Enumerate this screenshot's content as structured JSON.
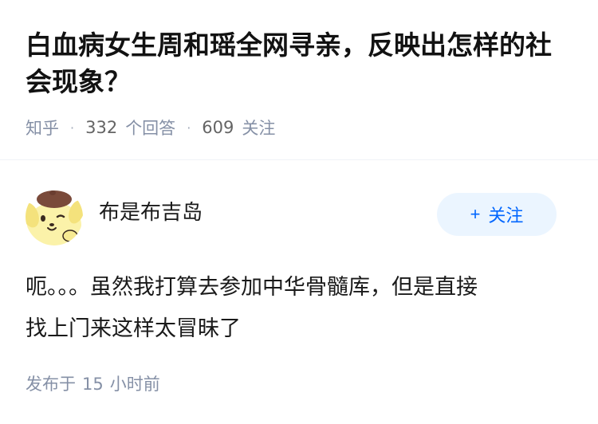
{
  "question": {
    "title": "白血病女生周和瑶全网寻亲，反映出怎样的社会现象？",
    "source": "知乎",
    "answer_count": "332",
    "answer_label": "个回答",
    "follower_count": "609",
    "follower_label": "关注"
  },
  "answer": {
    "author": {
      "name": "布是布吉岛",
      "avatar_icon": "pompompurin-avatar-icon"
    },
    "follow_button": {
      "icon": "plus-icon",
      "plus": "+",
      "label": "关注"
    },
    "lines": [
      "呃。。。虽然我打算去参加中华骨髓库，但是直接",
      "找上门来这样太冒昧了"
    ],
    "published_label": "发布于",
    "published_value": "15",
    "published_unit": "小时前"
  },
  "colors": {
    "primary_text": "#121212",
    "meta_text": "#8590a6",
    "accent_blue": "#0066ff",
    "follow_bg": "#ebf5ff",
    "avatar_yellow": "#fbf2a9",
    "avatar_brown": "#7a4a3a"
  }
}
